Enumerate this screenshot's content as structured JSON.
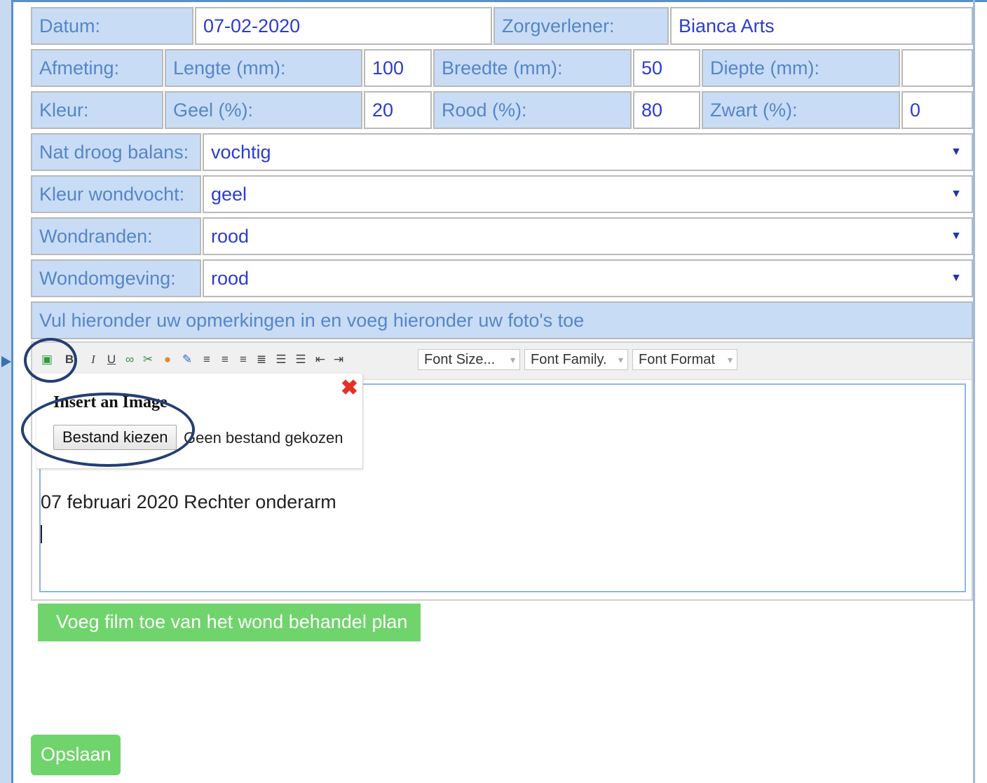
{
  "form": {
    "datum_label": "Datum:",
    "datum_value": "07-02-2020",
    "zorgverlener_label": "Zorgverlener:",
    "zorgverlener_value": "Bianca Arts",
    "afmeting_label": "Afmeting:",
    "lengte_label": "Lengte (mm):",
    "lengte_value": "100",
    "breedte_label": "Breedte (mm):",
    "breedte_value": "50",
    "diepte_label": "Diepte (mm):",
    "diepte_value": "",
    "kleur_label": "Kleur:",
    "geel_label": "Geel (%):",
    "geel_value": "20",
    "rood_label": "Rood (%):",
    "rood_value": "80",
    "zwart_label": "Zwart (%):",
    "zwart_value": "0",
    "nat_droog_label": "Nat droog balans:",
    "nat_droog_value": "vochtig",
    "kleur_wondvocht_label": "Kleur wondvocht:",
    "kleur_wondvocht_value": "geel",
    "wondranden_label": "Wondranden:",
    "wondranden_value": "rood",
    "wondomgeving_label": "Wondomgeving:",
    "wondomgeving_value": "rood",
    "remarks_instruction": "Vul hieronder uw opmerkingen in en voeg hieronder uw foto's toe"
  },
  "toolbar": {
    "font_size": "Font Size...",
    "font_family": "Font Family.",
    "font_format": "Font Format",
    "icons": [
      "insert-image-icon",
      "bold-icon",
      "italic-icon",
      "underline-icon",
      "link-icon",
      "unlink-icon",
      "color-icon",
      "html-icon",
      "align-left-icon",
      "align-center-icon",
      "align-right-icon",
      "justify-icon",
      "ordered-list-icon",
      "unordered-list-icon",
      "outdent-icon",
      "indent-icon"
    ]
  },
  "popup": {
    "title": "Insert an Image",
    "file_button": "Bestand kiezen",
    "file_status": "Geen bestand gekozen"
  },
  "editor": {
    "content": "07 februari 2020  Rechter onderarm"
  },
  "buttons": {
    "add_film": "Voeg film toe van het wond behandel plan",
    "save": "Opslaan"
  },
  "colors": {
    "label_bg": "#c9dcf5",
    "label_text": "#5586c8",
    "value_text": "#2b3cd0",
    "green_button": "#6fd46b",
    "annotation_ring": "#243f73",
    "close_icon": "#e53025"
  }
}
